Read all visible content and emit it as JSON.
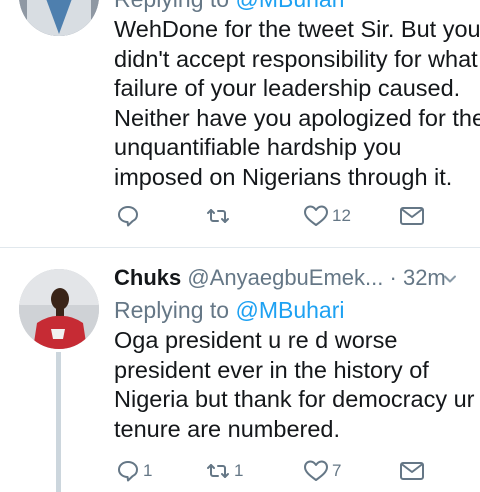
{
  "tweet1": {
    "reply_prefix": "Replying to ",
    "reply_handle": "@MBuhari",
    "body_lines": [
      "WehDone for the tweet Sir. But you",
      "didn't accept responsibility for what",
      "failure of your leadership caused.",
      "Neither have you apologized for the",
      "unquantifiable hardship you",
      "imposed on Nigerians through it."
    ],
    "reply_count": "",
    "retweet_count": "",
    "like_count": "12"
  },
  "tweet2": {
    "name": "Chuks",
    "screen_name": "@AnyaegbuEmek...",
    "separator": "·",
    "time": "32m",
    "reply_prefix": "Replying to ",
    "reply_handle": "@MBuhari",
    "body_lines": [
      "Oga president u re d worse",
      "president ever in the history of",
      "Nigeria but thank for democracy ur",
      "tenure are numbered."
    ],
    "reply_count": "1",
    "retweet_count": "1",
    "like_count": "7"
  },
  "colors": {
    "text": "#14171a",
    "secondary": "#657786",
    "accent": "#1da1f2",
    "divider": "#e1e8ed"
  },
  "icons": [
    "reply-icon",
    "retweet-icon",
    "like-icon",
    "direct-message-icon",
    "chevron-down-icon"
  ]
}
